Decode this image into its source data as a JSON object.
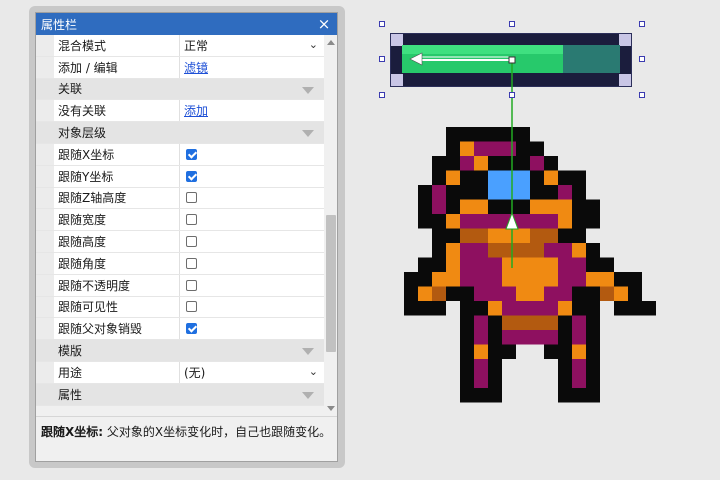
{
  "panel": {
    "title": "属性栏",
    "close_glyph": "×",
    "rows": [
      {
        "kind": "prop",
        "name": "混合模式",
        "value": "正常",
        "control": "select"
      },
      {
        "kind": "prop",
        "name": "添加 / 编辑",
        "value": "滤镜",
        "control": "link"
      },
      {
        "kind": "section",
        "name": "关联"
      },
      {
        "kind": "prop",
        "name": "没有关联",
        "value": "添加",
        "control": "link"
      },
      {
        "kind": "section",
        "name": "对象层级"
      },
      {
        "kind": "prop",
        "name": "跟随X坐标",
        "checked": true,
        "control": "checkbox"
      },
      {
        "kind": "prop",
        "name": "跟随Y坐标",
        "checked": true,
        "control": "checkbox"
      },
      {
        "kind": "prop",
        "name": "跟随Z轴高度",
        "checked": false,
        "control": "checkbox"
      },
      {
        "kind": "prop",
        "name": "跟随宽度",
        "checked": false,
        "control": "checkbox"
      },
      {
        "kind": "prop",
        "name": "跟随高度",
        "checked": false,
        "control": "checkbox"
      },
      {
        "kind": "prop",
        "name": "跟随角度",
        "checked": false,
        "control": "checkbox"
      },
      {
        "kind": "prop",
        "name": "跟随不透明度",
        "checked": false,
        "control": "checkbox"
      },
      {
        "kind": "prop",
        "name": "跟随可见性",
        "checked": false,
        "control": "checkbox"
      },
      {
        "kind": "prop",
        "name": "跟随父对象销毁",
        "checked": true,
        "control": "checkbox"
      },
      {
        "kind": "section",
        "name": "模版"
      },
      {
        "kind": "prop",
        "name": "用途",
        "value": "(无)",
        "control": "select"
      },
      {
        "kind": "section",
        "name": "属性"
      }
    ],
    "description": {
      "label": "跟随X坐标:",
      "text": "父对象的X坐标变化时，自己也跟随变化。"
    }
  },
  "canvas": {
    "health_bar": {
      "fill_fraction": 0.74
    },
    "colors": {
      "bar_frame": "#1b1d3d",
      "bar_fill": "#27c96b",
      "connector": "#22aa22",
      "selection_handle": "#3b3bb0"
    }
  }
}
